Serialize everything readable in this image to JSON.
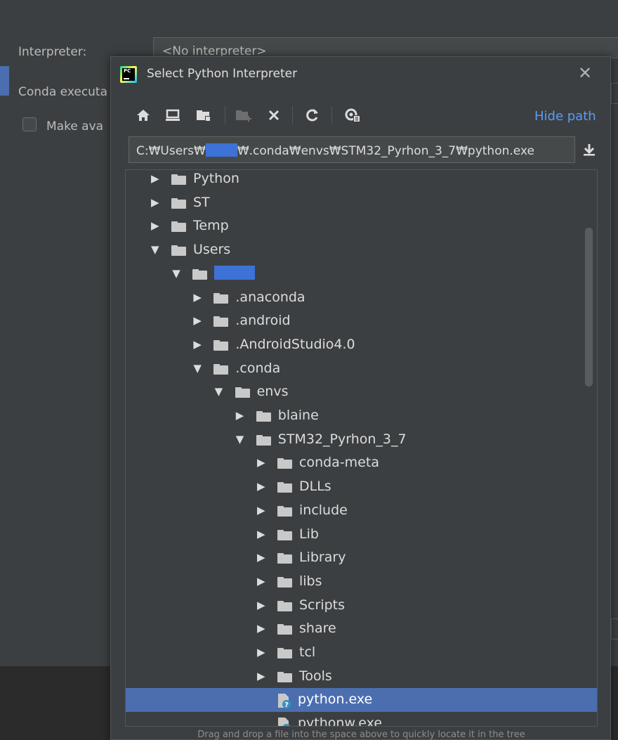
{
  "background": {
    "interpreter_label": "Interpreter:",
    "interpreter_value": "<No interpreter>",
    "conda_label": "Conda executa",
    "make_available_label": "Make ava"
  },
  "dialog": {
    "title": "Select Python Interpreter",
    "hide_path_label": "Hide path",
    "path_prefix": "C:₩Users₩",
    "path_suffix": "₩.conda₩envs₩STM32_Pyrhon_3_7₩python.exe",
    "drop_hint": "Drag and drop a file into the space above to quickly locate it in the tree",
    "toolbar_icons": [
      "home-icon",
      "desktop-icon",
      "project-folder-icon",
      "new-folder-icon",
      "delete-icon",
      "refresh-icon",
      "show-hidden-icon",
      "download-icon",
      "close-icon"
    ],
    "tree": [
      {
        "label": "Python",
        "expanded": false,
        "type": "folder"
      },
      {
        "label": "ST",
        "expanded": false,
        "type": "folder"
      },
      {
        "label": "Temp",
        "expanded": false,
        "type": "folder"
      },
      {
        "label": "Users",
        "expanded": true,
        "type": "folder"
      },
      {
        "label": "",
        "expanded": true,
        "type": "folder",
        "redacted": true
      },
      {
        "label": ".anaconda",
        "expanded": false,
        "type": "folder"
      },
      {
        "label": ".android",
        "expanded": false,
        "type": "folder"
      },
      {
        "label": ".AndroidStudio4.0",
        "expanded": false,
        "type": "folder"
      },
      {
        "label": ".conda",
        "expanded": true,
        "type": "folder"
      },
      {
        "label": "envs",
        "expanded": true,
        "type": "folder"
      },
      {
        "label": "blaine",
        "expanded": false,
        "type": "folder"
      },
      {
        "label": "STM32_Pyrhon_3_7",
        "expanded": true,
        "type": "folder"
      },
      {
        "label": "conda-meta",
        "expanded": false,
        "type": "folder"
      },
      {
        "label": "DLLs",
        "expanded": false,
        "type": "folder"
      },
      {
        "label": "include",
        "expanded": false,
        "type": "folder"
      },
      {
        "label": "Lib",
        "expanded": false,
        "type": "folder"
      },
      {
        "label": "Library",
        "expanded": false,
        "type": "folder"
      },
      {
        "label": "libs",
        "expanded": false,
        "type": "folder"
      },
      {
        "label": "Scripts",
        "expanded": false,
        "type": "folder"
      },
      {
        "label": "share",
        "expanded": false,
        "type": "folder"
      },
      {
        "label": "tcl",
        "expanded": false,
        "type": "folder"
      },
      {
        "label": "Tools",
        "expanded": false,
        "type": "folder"
      },
      {
        "label": "python.exe",
        "type": "python-file",
        "selected": true
      },
      {
        "label": "pythonw.exe",
        "type": "python-file"
      }
    ]
  },
  "colors": {
    "background": "#3c3f41",
    "selection": "#4b6eaf",
    "link": "#589df6",
    "redaction": "#3d72d7"
  }
}
